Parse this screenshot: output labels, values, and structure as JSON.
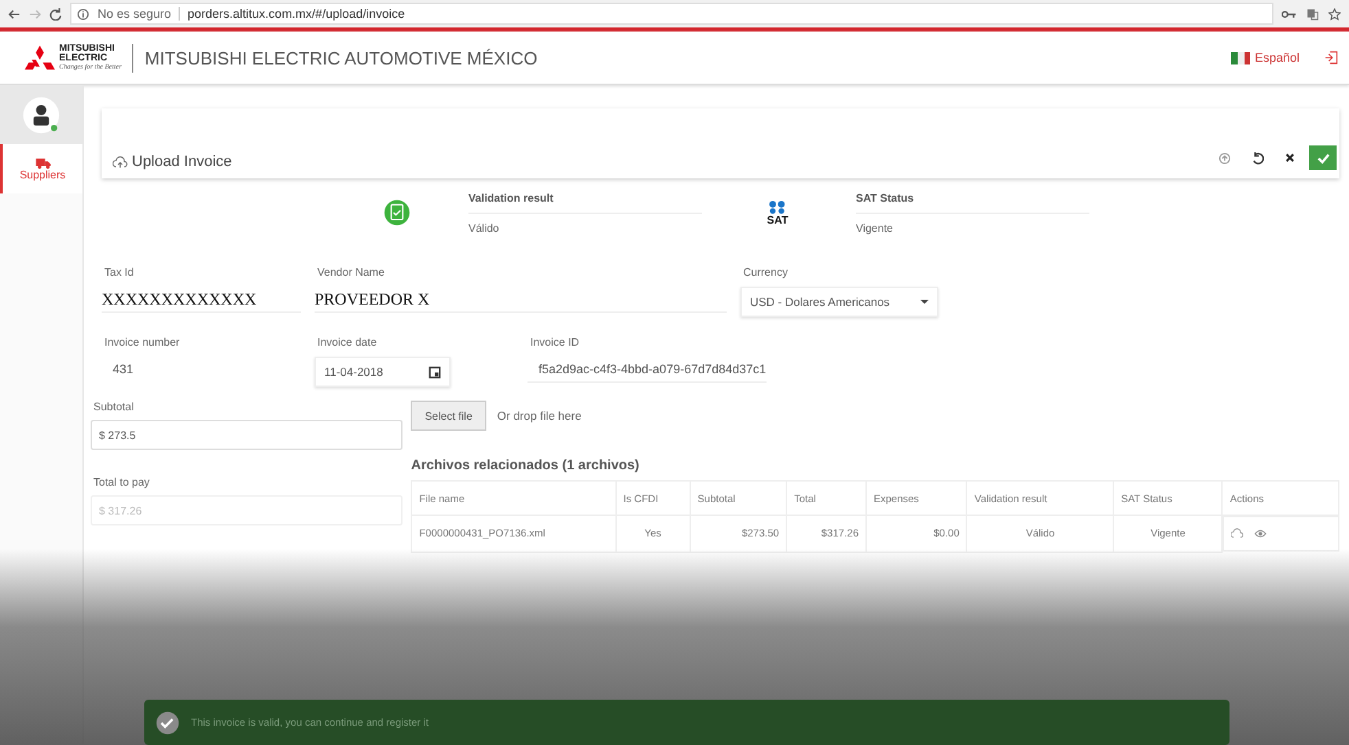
{
  "browser": {
    "security": "No es seguro",
    "url": "porders.altitux.com.mx/#/upload/invoice"
  },
  "header": {
    "logo_top": "MITSUBISHI",
    "logo_bottom": "ELECTRIC",
    "tagline": "Changes for the Better",
    "title": "MITSUBISHI ELECTRIC AUTOMOTIVE MÉXICO",
    "language": "Español"
  },
  "sidebar": {
    "items": [
      {
        "label": "Suppliers",
        "selected": true
      }
    ]
  },
  "panel": {
    "title": "Upload Invoice"
  },
  "validation": {
    "label": "Validation result",
    "value": "Válido",
    "sat_logo": "SAT",
    "sat_label": "SAT Status",
    "sat_value": "Vigente"
  },
  "fields": {
    "tax_id": {
      "label": "Tax Id",
      "value": "XXXXXXXXXXXXX"
    },
    "vendor": {
      "label": "Vendor Name",
      "value": "PROVEEDOR X"
    },
    "currency": {
      "label": "Currency",
      "value": "USD - Dolares Americanos"
    },
    "invoice_number": {
      "label": "Invoice number",
      "value": "431"
    },
    "invoice_date": {
      "label": "Invoice date",
      "value": "11-04-2018"
    },
    "invoice_id": {
      "label": "Invoice ID",
      "value": "f5a2d9ac-c4f3-4bbd-a079-67d7d84d37c1"
    },
    "subtotal": {
      "label": "Subtotal",
      "value": "$ 273.5"
    },
    "total": {
      "label": "Total to pay",
      "value": "$ 317.26",
      "disabled": true
    }
  },
  "upload": {
    "button": "Select file",
    "hint": "Or drop file here"
  },
  "files": {
    "title": "Archivos relacionados (1 archivos)",
    "columns": [
      "File name",
      "Is CFDI",
      "Subtotal",
      "Total",
      "Expenses",
      "Validation result",
      "SAT Status",
      "Actions"
    ],
    "rows": [
      [
        "F0000000431_PO7136.xml",
        "Yes",
        "$273.50",
        "$317.26",
        "$0.00",
        "Válido",
        "Vigente"
      ]
    ]
  },
  "toast": {
    "message": "This invoice is valid, you can continue and register it"
  }
}
